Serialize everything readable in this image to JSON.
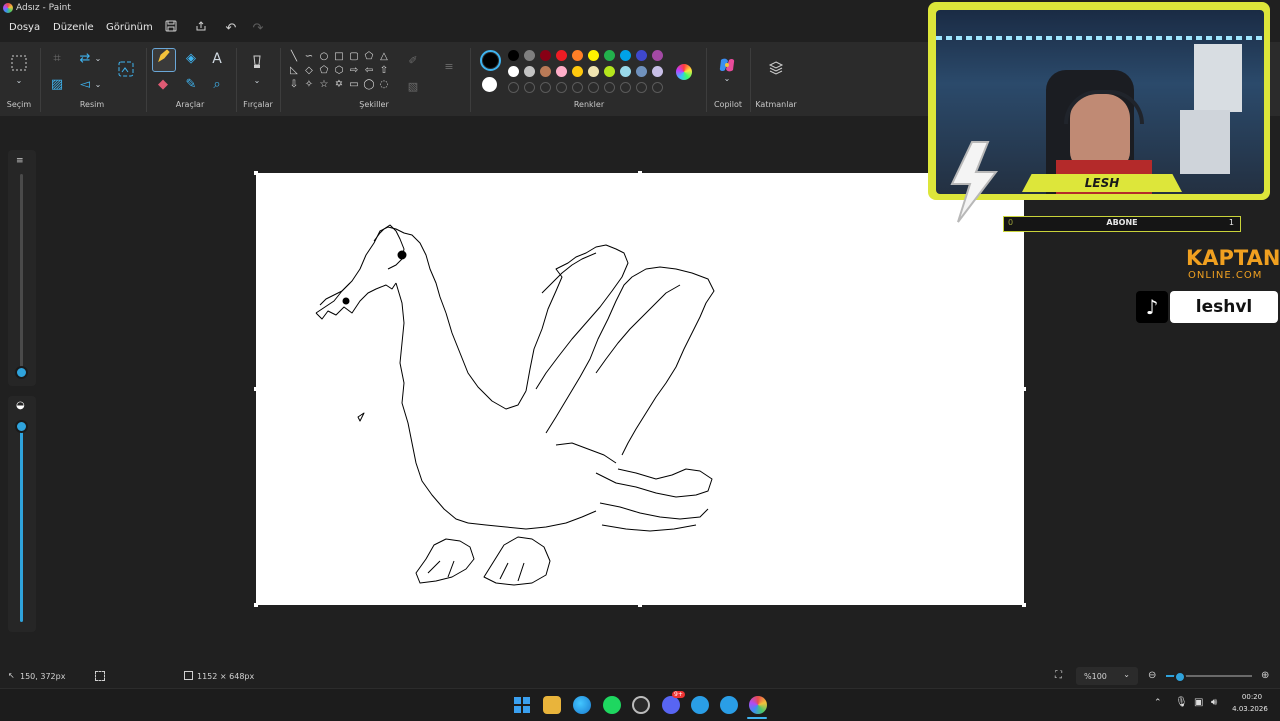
{
  "window": {
    "title": "Adsız - Paint"
  },
  "menu": {
    "file": "Dosya",
    "edit": "Düzenle",
    "view": "Görünüm"
  },
  "ribbon": {
    "groups": {
      "selection": "Seçim",
      "image": "Resim",
      "tools": "Araçlar",
      "brushes": "Fırçalar",
      "shapes": "Şekiller",
      "colors": "Renkler",
      "copilot": "Copilot",
      "layers": "Katmanlar"
    },
    "palette_row1": [
      "#000000",
      "#7f7f7f",
      "#880015",
      "#ed1c24",
      "#ff7f27",
      "#fff200",
      "#22b14c",
      "#00a2e8",
      "#3f48cc",
      "#a349a4"
    ],
    "palette_row2": [
      "#ffffff",
      "#c3c3c3",
      "#b97a57",
      "#ffaec9",
      "#ffc90e",
      "#efe4b0",
      "#b5e61d",
      "#99d9ea",
      "#7092be",
      "#c8bfe7"
    ],
    "primary_color": "#000000",
    "secondary_color": "#ffffff",
    "accent": "#3fb4f0"
  },
  "overlay": {
    "streamer_name": "LESH",
    "subscriber_label": "ABONE",
    "subscriber_left": "0",
    "subscriber_right": "1",
    "brand_top": "KAPTAN",
    "brand_bottom": "ONLINE.COM",
    "tiktok_handle": "leshvl",
    "frame_color": "#dde63a"
  },
  "statusbar": {
    "cursor_pos": "150, 372px",
    "canvas_size": "1152 × 648px",
    "zoom": "%100"
  },
  "taskbar": {
    "time": "00:20",
    "date": "4.03.2026",
    "discord_badge": "9+"
  }
}
